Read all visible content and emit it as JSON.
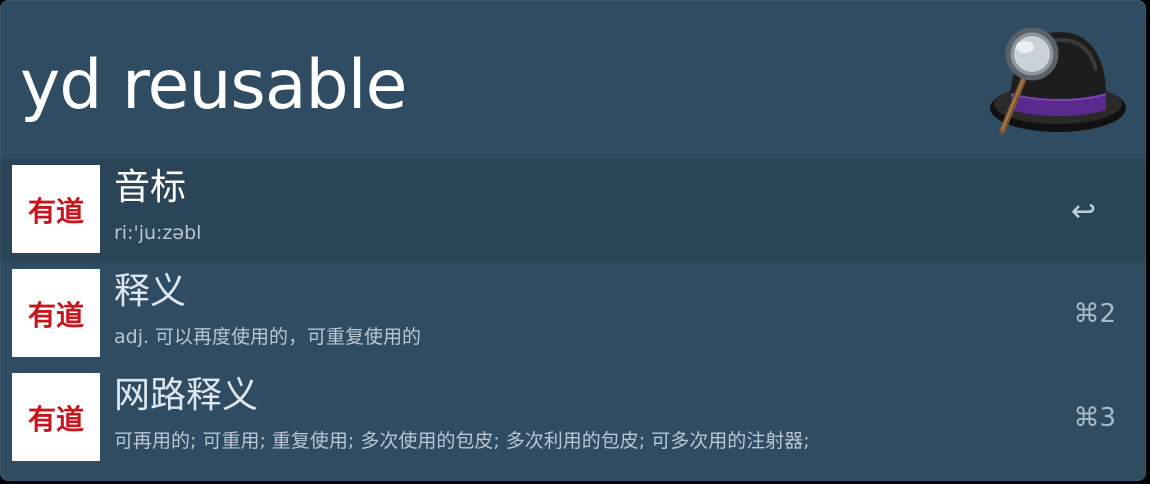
{
  "query": {
    "value": "yd reusable"
  },
  "app": {
    "icon_name": "alfred-hat-icon"
  },
  "results": [
    {
      "title": "音标",
      "subtitle": "ri:'ju:zəbl",
      "icon_text": "有道",
      "icon_name": "youdao-icon",
      "action_icon": "↩",
      "shortcut": "",
      "selected": true
    },
    {
      "title": "释义",
      "subtitle": "adj. 可以再度使用的，可重复使用的",
      "icon_text": "有道",
      "icon_name": "youdao-icon",
      "shortcut": "⌘2",
      "selected": false
    },
    {
      "title": "网路释义",
      "subtitle": "可再用的; 可重用; 重复使用; 多次使用的包皮; 多次利用的包皮; 可多次用的注射器;",
      "icon_text": "有道",
      "icon_name": "youdao-icon",
      "shortcut": "⌘3",
      "selected": false
    }
  ],
  "colors": {
    "window_bg": "#2f4c62",
    "selected_row": "#2a4558",
    "youdao_red": "#c5161d"
  }
}
